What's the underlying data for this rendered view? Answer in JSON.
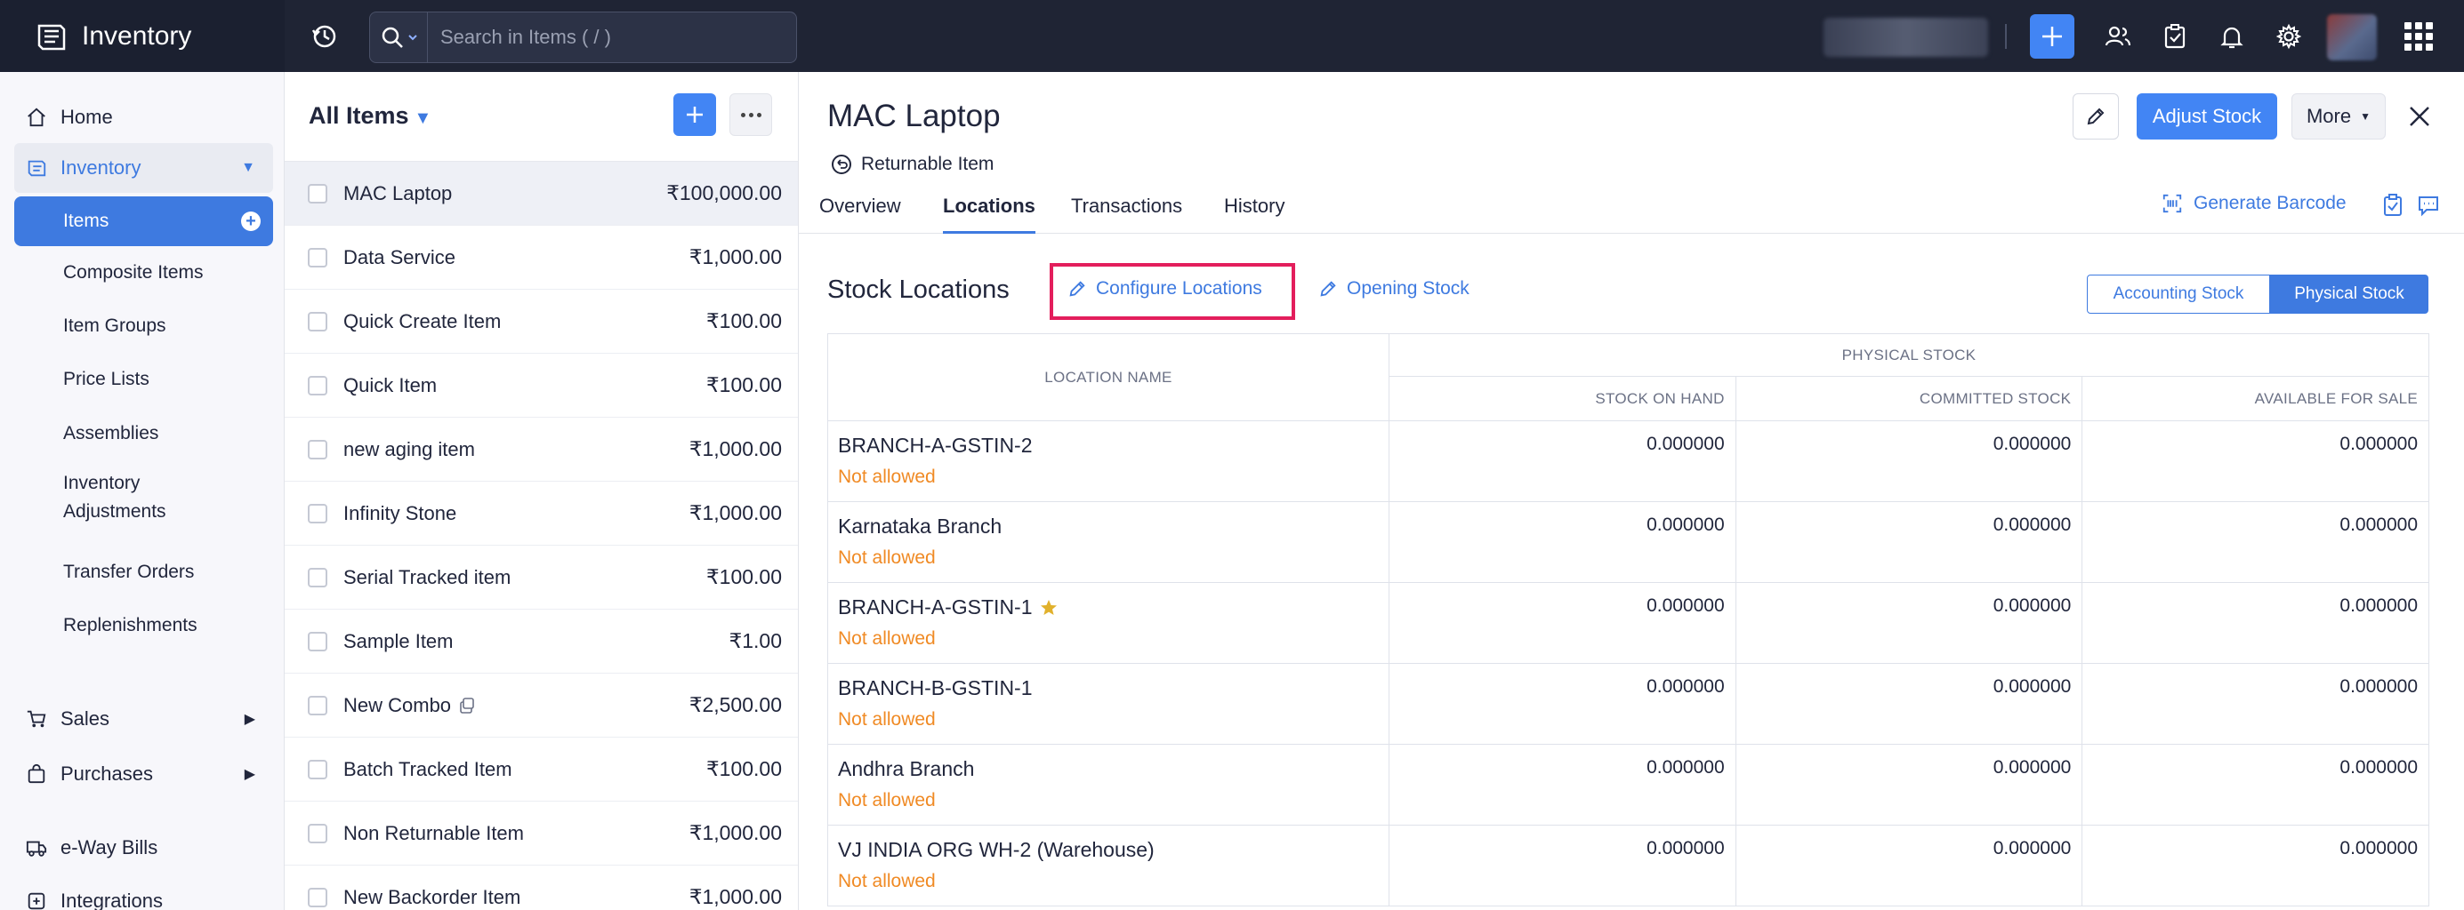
{
  "app": {
    "title": "Inventory"
  },
  "search": {
    "placeholder": "Search in Items ( / )"
  },
  "sidebar": {
    "home": "Home",
    "inventory": "Inventory",
    "inventory_items": [
      "Items",
      "Composite Items",
      "Item Groups",
      "Price Lists",
      "Assemblies",
      "Inventory Adjustments",
      "Transfer Orders",
      "Replenishments"
    ],
    "sales": "Sales",
    "purchases": "Purchases",
    "eway_bills": "e-Way Bills",
    "integrations": "Integrations"
  },
  "item_list": {
    "title": "All Items",
    "items": [
      {
        "name": "MAC Laptop",
        "price": "₹100,000.00"
      },
      {
        "name": "Data Service",
        "price": "₹1,000.00"
      },
      {
        "name": "Quick Create Item",
        "price": "₹100.00"
      },
      {
        "name": "Quick Item",
        "price": "₹100.00"
      },
      {
        "name": "new aging item",
        "price": "₹1,000.00"
      },
      {
        "name": "Infinity Stone",
        "price": "₹1,000.00"
      },
      {
        "name": "Serial Tracked item",
        "price": "₹100.00"
      },
      {
        "name": "Sample Item",
        "price": "₹1.00"
      },
      {
        "name": "New Combo",
        "price": "₹2,500.00"
      },
      {
        "name": "Batch Tracked Item",
        "price": "₹100.00"
      },
      {
        "name": "Non Returnable Item",
        "price": "₹1,000.00"
      },
      {
        "name": "New Backorder Item",
        "price": "₹1,000.00"
      }
    ]
  },
  "detail": {
    "title": "MAC Laptop",
    "returnable": "Returnable Item",
    "adjust_stock": "Adjust Stock",
    "more": "More",
    "tabs": [
      "Overview",
      "Locations",
      "Transactions",
      "History"
    ],
    "active_tab": "Locations",
    "generate_barcode": "Generate Barcode",
    "stock_locations_title": "Stock Locations",
    "configure_locations": "Configure Locations",
    "opening_stock": "Opening Stock",
    "toggle": {
      "accounting": "Accounting Stock",
      "physical": "Physical Stock",
      "selected": "Physical Stock"
    },
    "table": {
      "location_header": "LOCATION NAME",
      "group_header": "PHYSICAL STOCK",
      "columns": [
        "STOCK ON HAND",
        "COMMITTED STOCK",
        "AVAILABLE FOR SALE"
      ],
      "rows": [
        {
          "name": "BRANCH-A-GSTIN-2",
          "status": "Not allowed",
          "values": [
            "0.000000",
            "0.000000",
            "0.000000"
          ],
          "primary": false
        },
        {
          "name": "Karnataka Branch",
          "status": "Not allowed",
          "values": [
            "0.000000",
            "0.000000",
            "0.000000"
          ],
          "primary": false
        },
        {
          "name": "BRANCH-A-GSTIN-1",
          "status": "Not allowed",
          "values": [
            "0.000000",
            "0.000000",
            "0.000000"
          ],
          "primary": true
        },
        {
          "name": "BRANCH-B-GSTIN-1",
          "status": "Not allowed",
          "values": [
            "0.000000",
            "0.000000",
            "0.000000"
          ],
          "primary": false
        },
        {
          "name": "Andhra Branch",
          "status": "Not allowed",
          "values": [
            "0.000000",
            "0.000000",
            "0.000000"
          ],
          "primary": false
        },
        {
          "name": "VJ INDIA ORG WH-2 (Warehouse)",
          "status": "Not allowed",
          "values": [
            "0.000000",
            "0.000000",
            "0.000000"
          ],
          "primary": false
        }
      ]
    }
  },
  "colors": {
    "accent": "#4285f4",
    "link": "#3e7ae0",
    "warning": "#f08a24",
    "highlight_box": "#e31e5c",
    "topbar": "#1f2434"
  }
}
